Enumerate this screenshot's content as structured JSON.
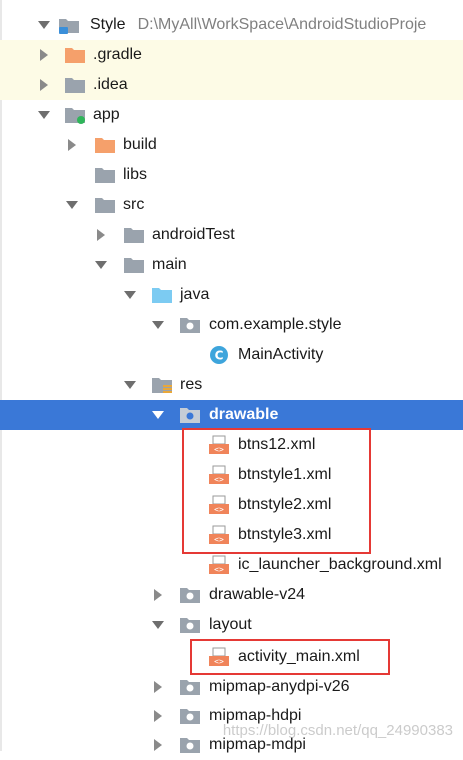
{
  "project": {
    "name": "Style",
    "path": "D:\\MyAll\\WorkSpace\\AndroidStudioProje"
  },
  "tree": [
    {
      "label": ".gradle",
      "icon": "folder-orange-icon",
      "expanded": false
    },
    {
      "label": ".idea",
      "icon": "folder-gray-icon",
      "expanded": false
    },
    {
      "label": "app",
      "icon": "module-folder-icon",
      "expanded": true
    },
    {
      "label": "build",
      "icon": "folder-orange-icon",
      "expanded": false
    },
    {
      "label": "libs",
      "icon": "folder-gray-icon"
    },
    {
      "label": "src",
      "icon": "folder-gray-icon",
      "expanded": true
    },
    {
      "label": "androidTest",
      "icon": "folder-gray-icon",
      "expanded": false
    },
    {
      "label": "main",
      "icon": "folder-gray-icon",
      "expanded": true
    },
    {
      "label": "java",
      "icon": "folder-blue-icon",
      "expanded": true
    },
    {
      "label": "com.example.style",
      "icon": "package-icon",
      "expanded": true
    },
    {
      "label": "MainActivity",
      "icon": "class-icon"
    },
    {
      "label": "res",
      "icon": "resource-folder-icon",
      "expanded": true
    },
    {
      "label": "drawable",
      "icon": "package-icon",
      "expanded": true,
      "selected": true
    },
    {
      "label": "btns12.xml",
      "icon": "xml-file-icon"
    },
    {
      "label": "btnstyle1.xml",
      "icon": "xml-file-icon"
    },
    {
      "label": "btnstyle2.xml",
      "icon": "xml-file-icon"
    },
    {
      "label": "btnstyle3.xml",
      "icon": "xml-file-icon"
    },
    {
      "label": "ic_launcher_background.xml",
      "icon": "xml-file-icon"
    },
    {
      "label": "drawable-v24",
      "icon": "package-icon",
      "expanded": false
    },
    {
      "label": "layout",
      "icon": "package-icon",
      "expanded": true
    },
    {
      "label": "activity_main.xml",
      "icon": "xml-file-icon"
    },
    {
      "label": "mipmap-anydpi-v26",
      "icon": "package-icon",
      "expanded": false
    },
    {
      "label": "mipmap-hdpi",
      "icon": "package-icon",
      "expanded": false
    },
    {
      "label": "mipmap-mdpi",
      "icon": "package-icon",
      "expanded": false
    }
  ],
  "watermark": "https://blog.csdn.net/qq_24990383",
  "colors": {
    "selection": "#3a78d7",
    "highlight_box": "#e53935",
    "folder_orange": "#f5a06b",
    "folder_gray": "#9aa3ad",
    "folder_blue": "#7ccbf2",
    "xml_orange": "#f0845a"
  }
}
